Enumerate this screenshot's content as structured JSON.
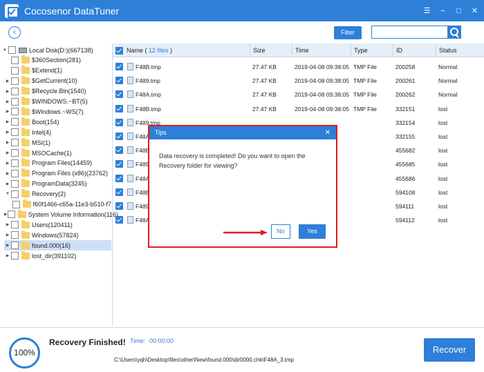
{
  "app": {
    "title": "Cocosenor DataTuner",
    "minimize": "☰",
    "min": "−",
    "max": "□",
    "close": "✕"
  },
  "toolbar": {
    "filter_label": "Filter",
    "search_placeholder": "",
    "back": "‹"
  },
  "tree": [
    {
      "label": "Local Disk(D:)(667138)",
      "level": 0,
      "expanded": true,
      "disk": true
    },
    {
      "label": "$360Section(281)",
      "level": 1
    },
    {
      "label": "$Extend(1)",
      "level": 1
    },
    {
      "label": "$GetCurrent(10)",
      "level": 1,
      "arrow": true
    },
    {
      "label": "$Recycle.Bin(1540)",
      "level": 1,
      "arrow": true
    },
    {
      "label": "$WINDOWS.~BT(5)",
      "level": 1,
      "arrow": true
    },
    {
      "label": "$Windows.~WS(7)",
      "level": 1,
      "arrow": true
    },
    {
      "label": "Boot(154)",
      "level": 1,
      "arrow": true
    },
    {
      "label": "Intel(4)",
      "level": 1,
      "arrow": true
    },
    {
      "label": "MSI(1)",
      "level": 1,
      "arrow": true
    },
    {
      "label": "MSOCache(1)",
      "level": 1,
      "arrow": true
    },
    {
      "label": "Program Files(14459)",
      "level": 1,
      "arrow": true
    },
    {
      "label": "Program Files (x86)(23762)",
      "level": 1,
      "arrow": true
    },
    {
      "label": "ProgramData(3245)",
      "level": 1,
      "arrow": true
    },
    {
      "label": "Recovery(2)",
      "level": 1,
      "expanded": true
    },
    {
      "label": "f60f1466-c65a-11e3-b510-f7",
      "level": 2
    },
    {
      "label": "System Volume Information(116)",
      "level": 1,
      "arrow": true
    },
    {
      "label": "Users(120411)",
      "level": 1,
      "arrow": true
    },
    {
      "label": "Windows(57824)",
      "level": 1,
      "arrow": true
    },
    {
      "label": "found.000(16)",
      "level": 1,
      "arrow": true,
      "selected": true
    },
    {
      "label": "lost_dir(391102)",
      "level": 1,
      "arrow": true
    }
  ],
  "table": {
    "header": {
      "name_prefix": "Name ( ",
      "count": "12 files",
      "name_suffix": " )",
      "size": "Size",
      "time": "Time",
      "type": "Type",
      "id": "ID",
      "status": "Status"
    },
    "rows": [
      {
        "name": "F48B.tmp",
        "size": "27.47 KB",
        "time": "2019-04-08 09:38:05",
        "type": "TMP File",
        "id": "200258",
        "status": "Normal"
      },
      {
        "name": "F489.tmp",
        "size": "27.47 KB",
        "time": "2019-04-08 09:38:05",
        "type": "TMP File",
        "id": "200261",
        "status": "Normal"
      },
      {
        "name": "F48A.tmp",
        "size": "27.47 KB",
        "time": "2019-04-08 09:38:05",
        "type": "TMP File",
        "id": "200262",
        "status": "Normal"
      },
      {
        "name": "F48B.tmp",
        "size": "27.47 KB",
        "time": "2019-04-08 09:38:05",
        "type": "TMP File",
        "id": "332151",
        "status": "lost"
      },
      {
        "name": "F489.tmp",
        "size": "",
        "time": "",
        "type": "",
        "id": "332154",
        "status": "lost"
      },
      {
        "name": "F48A",
        "size": "",
        "time": "",
        "type": "",
        "id": "332155",
        "status": "lost"
      },
      {
        "name": "F48B",
        "size": "",
        "time": "",
        "type": "",
        "id": "455682",
        "status": "lost"
      },
      {
        "name": "F489",
        "size": "",
        "time": "",
        "type": "",
        "id": "455685",
        "status": "lost"
      },
      {
        "name": "F48A",
        "size": "",
        "time": "",
        "type": "",
        "id": "455686",
        "status": "lost"
      },
      {
        "name": "F48B",
        "size": "",
        "time": "",
        "type": "",
        "id": "594108",
        "status": "lost"
      },
      {
        "name": "F489",
        "size": "",
        "time": "",
        "type": "",
        "id": "594111",
        "status": "lost"
      },
      {
        "name": "F48A",
        "size": "",
        "time": "",
        "type": "",
        "id": "594112",
        "status": "lost"
      }
    ]
  },
  "dialog": {
    "title": "Tips",
    "close": "✕",
    "message": "Data recovery is completed! Do you want to open the Recovery folder for viewing?",
    "no_label": "No",
    "yes_label": "Yes"
  },
  "footer": {
    "progress": "100%",
    "status": "Recovery Finished!",
    "time_label": "Time:",
    "time_value": "00:00:00",
    "path": "C:\\Users\\yqh\\Desktop\\files\\other\\New\\found.000\\dir0000.chk\\F48A_3.tmp",
    "recover_label": "Recover"
  },
  "colors": {
    "accent": "#2e7fd8",
    "highlight": "#e01b1b"
  }
}
